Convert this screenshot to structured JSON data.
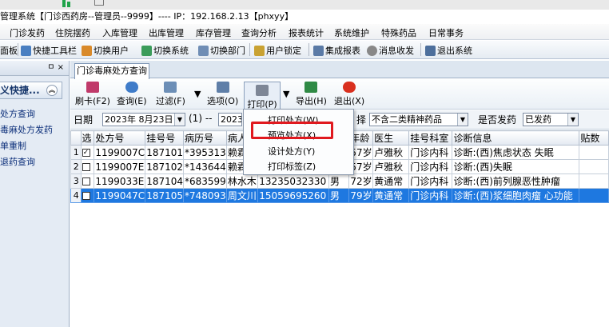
{
  "window_title": "管理系统【门诊西药房--管理员--9999】---- IP：192.168.2.13【phxyy】",
  "menu": [
    "门诊发药",
    "住院摆药",
    "入库管理",
    "出库管理",
    "库存管理",
    "查询分析",
    "报表统计",
    "系统维护",
    "特殊药品",
    "日常事务"
  ],
  "toolbar": [
    "面板",
    "快捷工具栏",
    "切换用户",
    "切换系统",
    "切换部门",
    "用户锁定",
    "集成报表",
    "消息收发",
    "退出系统"
  ],
  "left_panel": {
    "pin": "ㅁ ×",
    "title": "义快捷...",
    "toggle": "︽",
    "items": [
      "处方查询",
      "毒麻处方发药",
      "单重制",
      "退药查询"
    ]
  },
  "tab": "门诊毒麻处方查询",
  "ribbon": [
    "刷卡(F2)",
    "查询(E)",
    "过滤(F)",
    "选项(O)",
    "打印(P)",
    "导出(H)",
    "退出(X)"
  ],
  "filter": {
    "date_label": "日期",
    "date_from": "2023年 8月23日",
    "sep": "(1) --",
    "date_to": "2023年",
    "select_label": "择",
    "drug_type": "不含二类精神药品",
    "dispensed_label": "是否发药",
    "dispensed": "已发药"
  },
  "columns": [
    "选",
    "处方号",
    "挂号号",
    "病历号",
    "病人",
    "",
    "",
    "年龄",
    "医生",
    "挂号科室",
    "诊断信息",
    "贴数"
  ],
  "rows": [
    {
      "n": "1",
      "checked": "✓",
      "rx": "1199007C",
      "reg": "187101",
      "med": "*395313",
      "name": "赖霖",
      "phone": "",
      "sex": "",
      "age": "57岁",
      "doctor": "卢雅秋",
      "dept": "门诊内科",
      "diag": "诊断:(西)焦虑状态 失眠"
    },
    {
      "n": "2",
      "checked": "",
      "rx": "1199007E",
      "reg": "187102",
      "med": "*143644",
      "name": "赖霖",
      "phone": "",
      "sex": "",
      "age": "57岁",
      "doctor": "卢雅秋",
      "dept": "门诊内科",
      "diag": "诊断:(西)失眠"
    },
    {
      "n": "3",
      "checked": "",
      "rx": "1199033E",
      "reg": "187104",
      "med": "*683599",
      "name": "林水木",
      "phone": "13235032330",
      "sex": "男",
      "age": "72岁",
      "doctor": "黄通常",
      "dept": "门诊内科",
      "diag": "诊断:(西)前列腺恶性肿瘤"
    },
    {
      "n": "4",
      "checked": "",
      "rx": "1199047C",
      "reg": "187105",
      "med": "*748093",
      "name": "周文川",
      "phone": "15059695260",
      "sex": "男",
      "age": "79岁",
      "doctor": "黄通常",
      "dept": "门诊内科",
      "diag": "诊断:(西)浆细胞肉瘤 心功能"
    }
  ],
  "print_menu": [
    "打印处方(W)",
    "预览处方(X)",
    "设计处方(Y)",
    "打印标签(Z)"
  ]
}
